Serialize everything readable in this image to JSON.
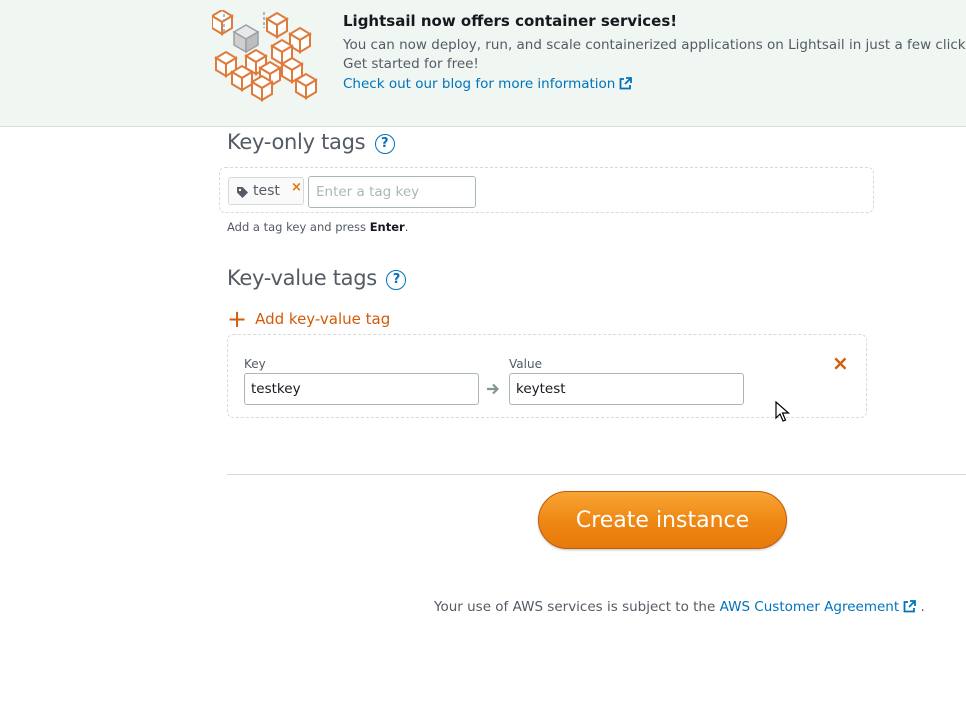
{
  "banner": {
    "title": "Lightsail now offers container services!",
    "body": "You can now deploy, run, and scale containerized applications on Lightsail in just a few clicks. Get started for free!",
    "link_text": "Check out our blog for more information",
    "logo_icon": "containers-cube-cluster-icon"
  },
  "key_only_tags": {
    "heading": "Key-only tags",
    "help_icon": "?",
    "tags": [
      {
        "label": "test",
        "remove_icon": "×"
      }
    ],
    "input_placeholder": "Enter a tag key",
    "hint_prefix": "Add a tag key and press ",
    "hint_key": "Enter",
    "hint_suffix": "."
  },
  "key_value_tags": {
    "heading": "Key-value tags",
    "help_icon": "?",
    "add_label": "Add key-value tag",
    "add_icon": "+",
    "rows": [
      {
        "key_label": "Key",
        "key_value": "testkey",
        "value_label": "Value",
        "value_value": "keytest",
        "remove_icon": "×"
      }
    ]
  },
  "actions": {
    "create_label": "Create instance"
  },
  "footer": {
    "prefix": "Your use of AWS services is subject to the",
    "link_text": "AWS Customer Agreement",
    "suffix": "."
  },
  "colors": {
    "accent_orange": "#ec7211",
    "link_blue": "#0073bb",
    "banner_bg": "#f0f6f1"
  }
}
